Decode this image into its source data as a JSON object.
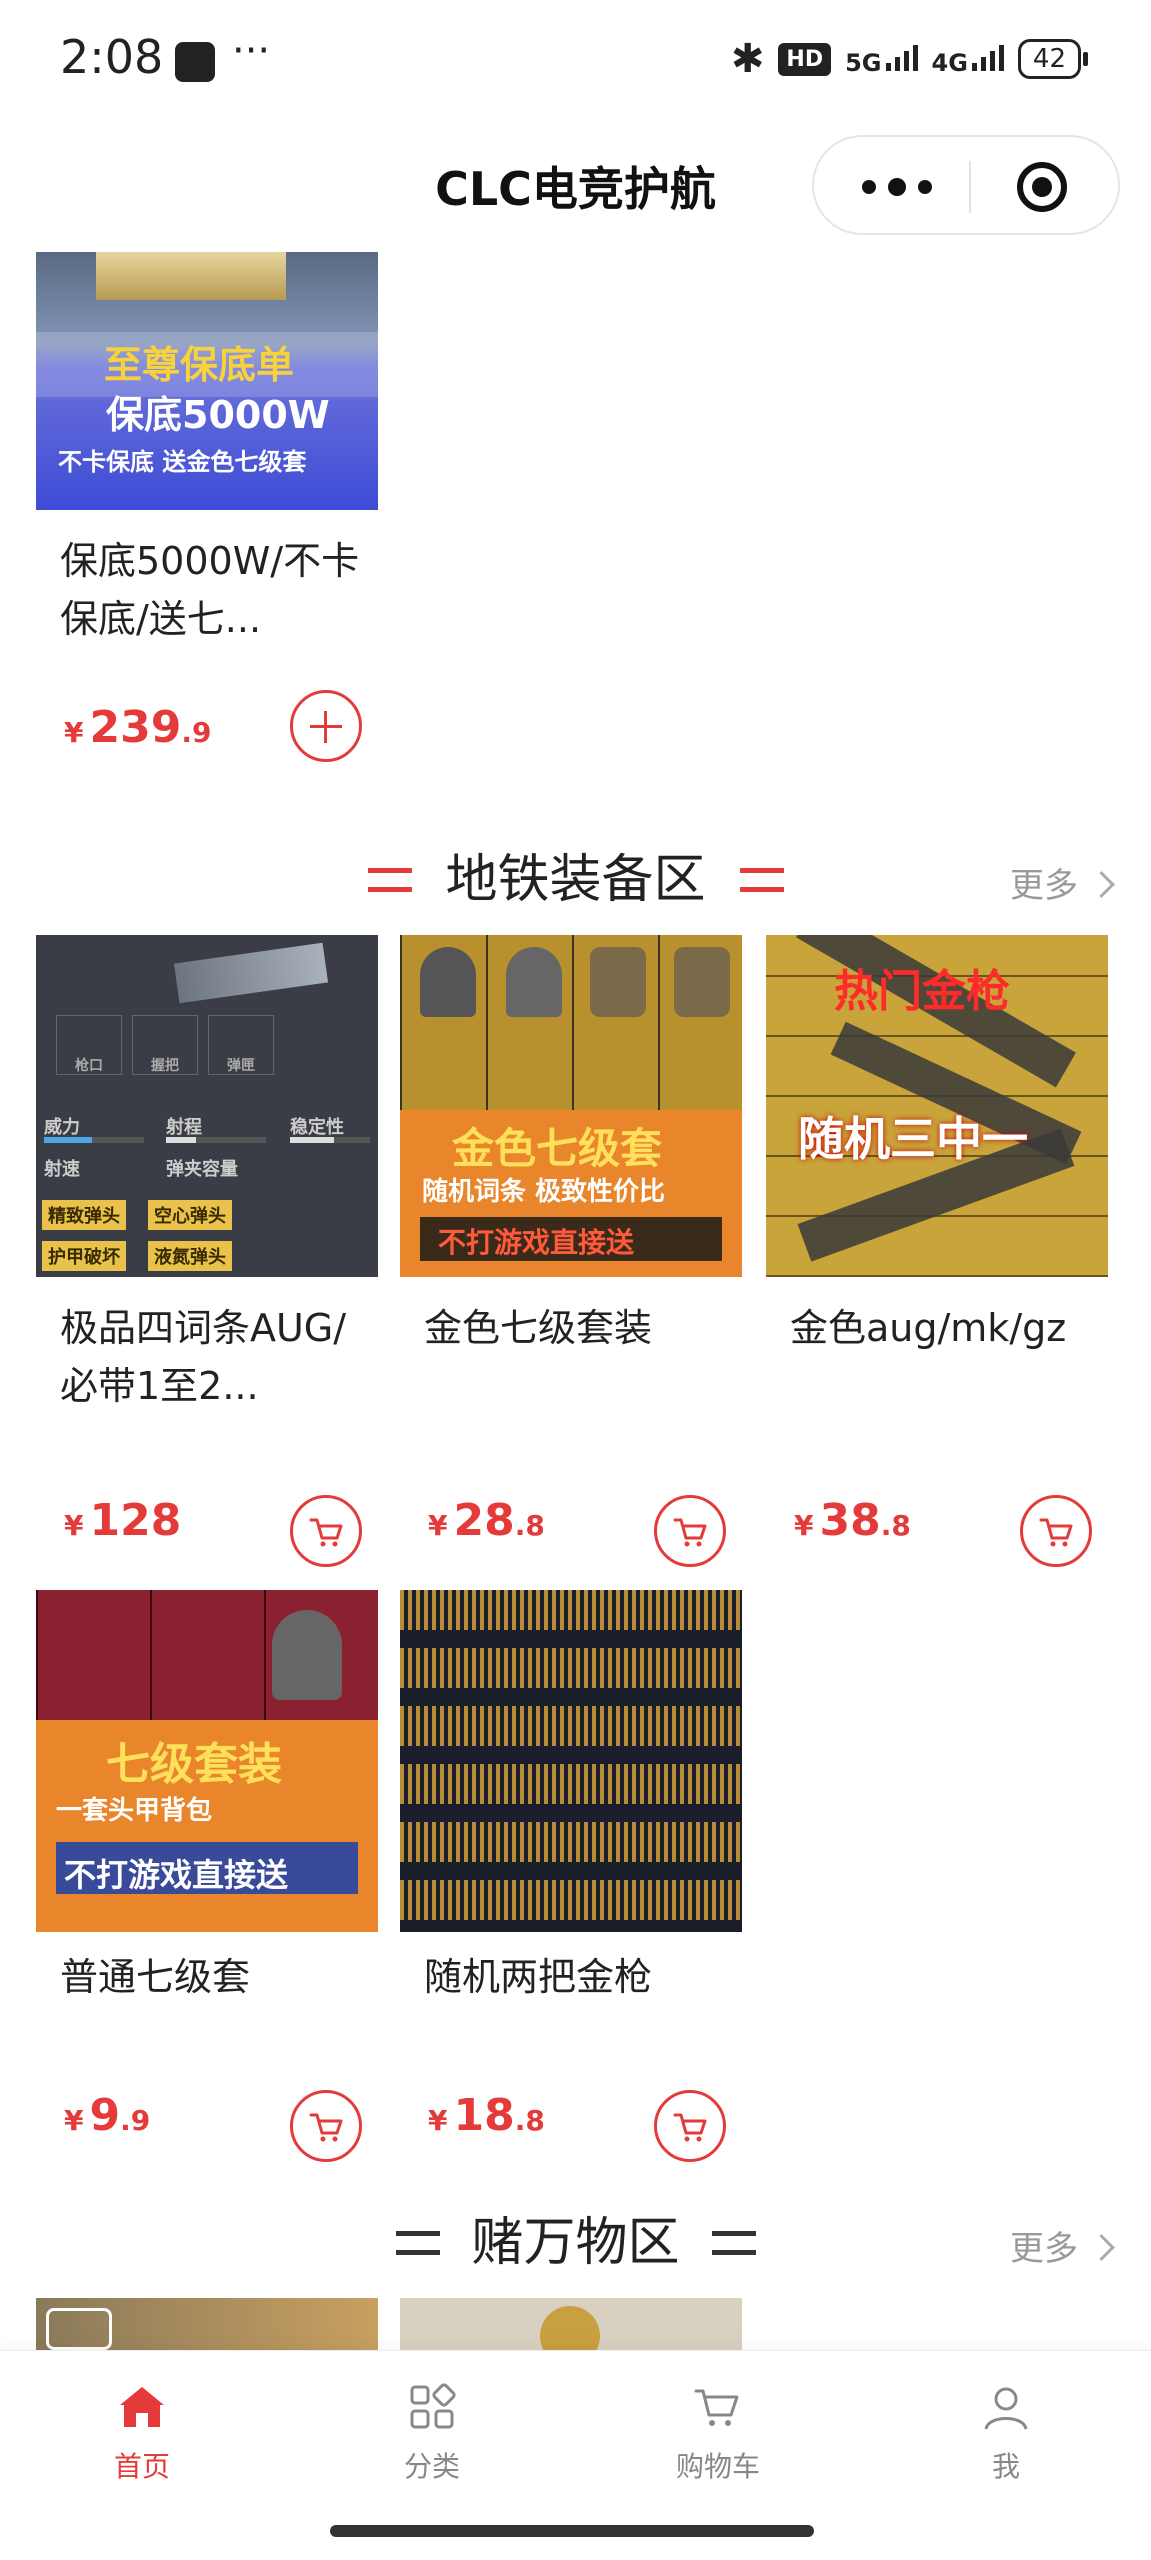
{
  "status_bar": {
    "time": "2:08",
    "dots": "···",
    "hd": "HD",
    "sig1": "5G",
    "sig2": "4G",
    "battery": "42"
  },
  "header": {
    "title": "CLC电竞护航"
  },
  "colors": {
    "accent": "#e53a3a"
  },
  "currency": "¥",
  "top_item": {
    "name": "保底5000W/不卡保底/送七...",
    "price_int": "239",
    "price_dec": ".9",
    "image_text": {
      "line1": "至尊保底单",
      "line2": "保底5000W",
      "line3": "不卡保底 送金色七级套"
    }
  },
  "sections": [
    {
      "title": "地铁装备区",
      "more": "更多",
      "items": [
        {
          "name": "极品四词条AUG/ 必带1至2...",
          "price_int": "128",
          "price_dec": "",
          "image_text": {
            "slots": [
              "枪口",
              "握把",
              "弹匣"
            ],
            "stats": [
              "威力",
              "射程",
              "稳定性",
              "射速",
              "弹夹容量"
            ],
            "tags": [
              "精致弹头",
              "空心弹头",
              "护甲破坏",
              "液氮弹头"
            ]
          }
        },
        {
          "name": "金色七级套装",
          "price_int": "28",
          "price_dec": ".8",
          "image_text": {
            "line1": "金色七级套",
            "line2": "随机词条 极致性价比",
            "line3": "不打游戏直接送"
          }
        },
        {
          "name": "金色aug/mk/gz",
          "price_int": "38",
          "price_dec": ".8",
          "image_text": {
            "line1": "热门金枪",
            "line2": "随机三中一"
          }
        },
        {
          "name": "普通七级套",
          "price_int": "9",
          "price_dec": ".9",
          "image_text": {
            "line1": "七级套装",
            "line2": "一套头甲背包",
            "line3": "不打游戏直接送"
          }
        },
        {
          "name": "随机两把金枪",
          "price_int": "18",
          "price_dec": ".8"
        }
      ]
    },
    {
      "title": "赌万物区",
      "more": "更多"
    }
  ],
  "tabs": [
    {
      "label": "首页",
      "icon": "home-icon",
      "active": true
    },
    {
      "label": "分类",
      "icon": "category-icon"
    },
    {
      "label": "购物车",
      "icon": "cart-icon"
    },
    {
      "label": "我",
      "icon": "user-icon"
    }
  ]
}
